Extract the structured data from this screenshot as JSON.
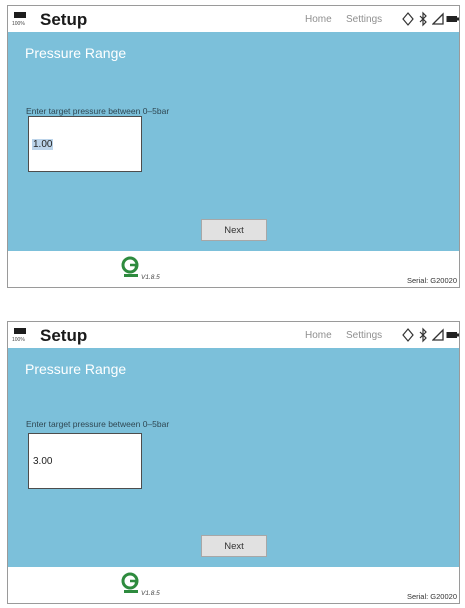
{
  "screens": [
    {
      "battery_percent": "100%",
      "title": "Setup",
      "nav_home": "Home",
      "nav_settings": "Settings",
      "panel_title": "Pressure Range",
      "prompt": "Enter target pressure between 0–5bar",
      "input_value": "1.00",
      "input_selected": true,
      "next_label": "Next",
      "version": "V1.8.5",
      "serial": "Serial: G20020"
    },
    {
      "battery_percent": "100%",
      "title": "Setup",
      "nav_home": "Home",
      "nav_settings": "Settings",
      "panel_title": "Pressure Range",
      "prompt": "Enter target pressure between 0–5bar",
      "input_value": "3.00",
      "input_selected": false,
      "next_label": "Next",
      "version": "V1.8.5",
      "serial": "Serial: G20020"
    }
  ],
  "icons": [
    "battery-icon",
    "location-icon",
    "bluetooth-icon",
    "signal-icon",
    "battery-full-icon",
    "logo-icon"
  ],
  "colors": {
    "panel": "#7cc0da",
    "panel_title": "#ffffff",
    "logo": "#2e8b3e",
    "selection": "#bcd4ea"
  }
}
